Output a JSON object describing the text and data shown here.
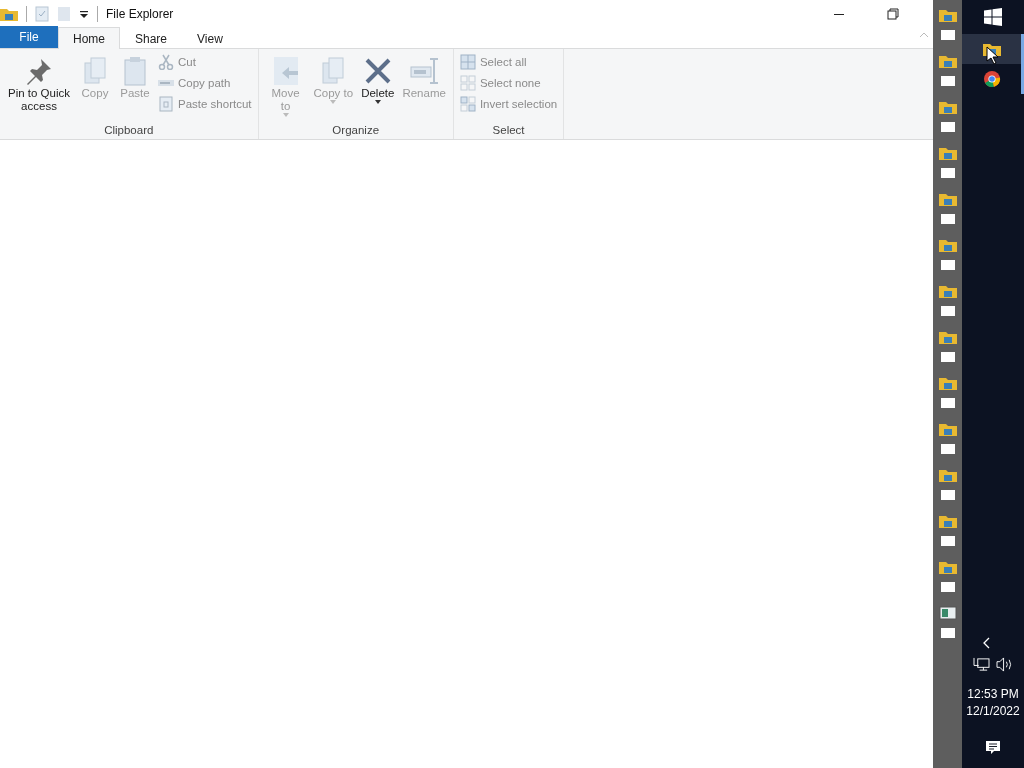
{
  "window": {
    "title": "File Explorer"
  },
  "tabs": [
    {
      "label": "File",
      "kind": "file",
      "selected": false
    },
    {
      "label": "Home",
      "kind": "tab",
      "selected": true
    },
    {
      "label": "Share",
      "kind": "tab",
      "selected": false
    },
    {
      "label": "View",
      "kind": "tab",
      "selected": false
    }
  ],
  "ribbon": [
    {
      "name": "Clipboard",
      "items": [
        {
          "kind": "large",
          "label": "Pin to Quick access",
          "dropdown": false,
          "disabled": false
        },
        {
          "kind": "large",
          "label": "Copy",
          "dropdown": false,
          "disabled": true
        },
        {
          "kind": "large",
          "label": "Paste",
          "dropdown": false,
          "disabled": true
        },
        {
          "kind": "stack",
          "items": [
            {
              "label": "Cut",
              "disabled": true
            },
            {
              "label": "Copy path",
              "disabled": true
            },
            {
              "label": "Paste shortcut",
              "disabled": true
            }
          ]
        }
      ]
    },
    {
      "name": "Organize",
      "items": [
        {
          "kind": "large",
          "label": "Move to",
          "dropdown": true,
          "disabled": true
        },
        {
          "kind": "large",
          "label": "Copy to",
          "dropdown": true,
          "disabled": true
        },
        {
          "kind": "large",
          "label": "Delete",
          "dropdown": true,
          "disabled": false
        },
        {
          "kind": "large",
          "label": "Rename",
          "dropdown": false,
          "disabled": true
        }
      ]
    },
    {
      "name": "Select",
      "items": [
        {
          "kind": "stack",
          "items": [
            {
              "label": "Select all",
              "disabled": true
            },
            {
              "label": "Select none",
              "disabled": true
            },
            {
              "label": "Invert selection",
              "disabled": true
            }
          ]
        }
      ]
    }
  ],
  "strip": [
    {
      "kind": "folder"
    },
    {
      "kind": "folder"
    },
    {
      "kind": "folder"
    },
    {
      "kind": "folder"
    },
    {
      "kind": "folder"
    },
    {
      "kind": "folder"
    },
    {
      "kind": "folder"
    },
    {
      "kind": "folder"
    },
    {
      "kind": "folder"
    },
    {
      "kind": "folder"
    },
    {
      "kind": "folder"
    },
    {
      "kind": "folder"
    },
    {
      "kind": "folder"
    },
    {
      "kind": "window"
    }
  ],
  "taskbar": {
    "apps": [
      {
        "kind": "folder",
        "selected": true
      },
      {
        "kind": "chrome",
        "selected": false
      }
    ],
    "time": "12:53 PM",
    "date": "12/1/2022"
  }
}
